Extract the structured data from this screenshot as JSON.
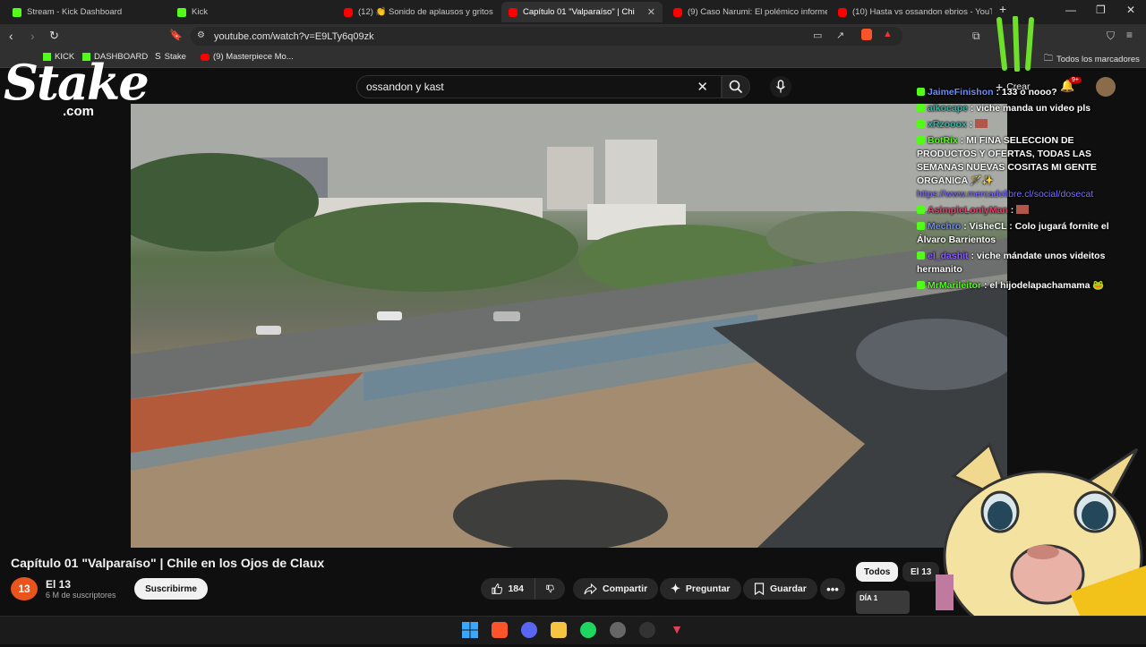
{
  "browser": {
    "tabs": [
      {
        "title": "Stream - Kick Dashboard",
        "favicon": "kick-icon",
        "active": false
      },
      {
        "title": "Kick",
        "favicon": "kick-icon",
        "active": false
      },
      {
        "title": "(12) 👏 Sonido de aplausos y gritos",
        "favicon": "youtube-icon",
        "active": false
      },
      {
        "title": "Capítulo 01 \"Valparaíso\" | Chi",
        "favicon": "youtube-icon",
        "active": true
      },
      {
        "title": "(9) Caso Narumi: El polémico informe",
        "favicon": "youtube-icon",
        "active": false
      },
      {
        "title": "(10) Hasta vs ossandon ebrios - YouT",
        "favicon": "youtube-icon",
        "active": false
      }
    ],
    "new_tab": "+",
    "url": "youtube.com/watch?v=E9LTy6q09zk",
    "bookmarks": [
      {
        "label": "KICK",
        "icon": "kick-icon"
      },
      {
        "label": "DASHBOARD",
        "icon": "kick-icon"
      },
      {
        "label": "Stake",
        "icon": "stake-icon"
      },
      {
        "label": "(9) Masterpiece Mo...",
        "icon": "youtube-icon"
      }
    ],
    "all_bookmarks": "Todos los marcadores"
  },
  "youtube": {
    "search_value": "ossandon y kast",
    "create_label": "Crear",
    "notifications_badge": "9+",
    "video": {
      "title": "Capítulo 01 \"Valparaíso\" | Chile en los Ojos de Claux",
      "channel_initial": "13",
      "channel_name": "El 13",
      "subscribers": "6 M de suscriptores",
      "subscribe_label": "Suscribirme",
      "likes": "184",
      "share_label": "Compartir",
      "ask_label": "Preguntar",
      "save_label": "Guardar"
    },
    "chips": [
      {
        "label": "Todos",
        "selected": true
      },
      {
        "label": "El 13",
        "selected": false
      }
    ],
    "thumb_badge": "DÍA 1"
  },
  "overlay": {
    "stake_logo": "Stake",
    "stake_sub": ".com",
    "chat": [
      {
        "user": "JaimeFinishon",
        "user_color": "#6a8bff",
        "text": ": 133 o nooo?"
      },
      {
        "user": "aikocape",
        "user_color": "#2fb3a0",
        "text": ": viche manda un video pls"
      },
      {
        "user": "xRzooox",
        "user_color": "#2fb3a0",
        "text": ":"
      },
      {
        "user": "BotRix",
        "user_color": "#53fc18",
        "text": ": MI FINA SELECCION DE PRODUCTOS Y OFERTAS, TODAS LAS SEMANAS NUEVAS COSITAS MI GENTE ORGANICA 🪄✨",
        "link": "https://www.mercadolibre.cl/social/dosecat"
      },
      {
        "user": "AsimpleLonlyMan",
        "user_color": "#e0406a",
        "text": ":"
      },
      {
        "user": "Mechro",
        "user_color": "#6a8bff",
        "text": ": VisheCL : Colo jugará fornite el Álvaro Barrientos"
      },
      {
        "user": "el_dashit",
        "user_color": "#8a5cff",
        "text": ": viche mándate unos videitos hermanito"
      },
      {
        "user": "MrMarileitor",
        "user_color": "#53fc18",
        "text": ": el hijodelapachamama 🐸"
      }
    ]
  },
  "colors": {
    "kick_green": "#53fc18",
    "youtube_red": "#ff0000",
    "background": "#0f0f0f"
  }
}
